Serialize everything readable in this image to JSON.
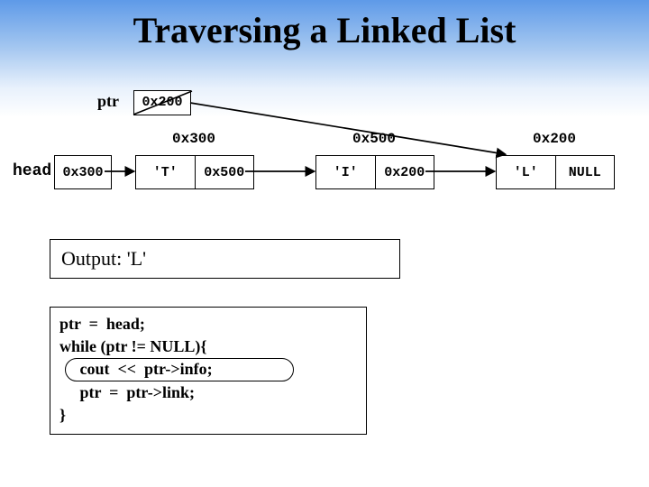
{
  "title": "Traversing a Linked List",
  "ptr": {
    "label": "ptr",
    "value": "0x200"
  },
  "head": {
    "label": "head",
    "value": "0x300"
  },
  "nodes": [
    {
      "addr": "0x300",
      "info": "'T'",
      "link": "0x500"
    },
    {
      "addr": "0x500",
      "info": "'I'",
      "link": "0x200"
    },
    {
      "addr": "0x200",
      "info": "'L'",
      "link": "NULL"
    }
  ],
  "output": {
    "label": "Output:",
    "value": "'L'"
  },
  "code": {
    "lines": [
      "ptr  =  head;",
      "while (ptr != NULL){",
      "     cout  <<  ptr->info;",
      "     ptr  =  ptr->link;",
      "}"
    ]
  },
  "chart_data": {
    "type": "table",
    "title": "Traversing a Linked List",
    "ptr_current": "0x200",
    "head": "0x300",
    "linked_list": [
      {
        "address": "0x300",
        "info": "T",
        "link": "0x500"
      },
      {
        "address": "0x500",
        "info": "I",
        "link": "0x200"
      },
      {
        "address": "0x200",
        "info": "L",
        "link": null
      }
    ],
    "output_so_far": "L",
    "highlighted_statement": "cout << ptr->info;"
  }
}
